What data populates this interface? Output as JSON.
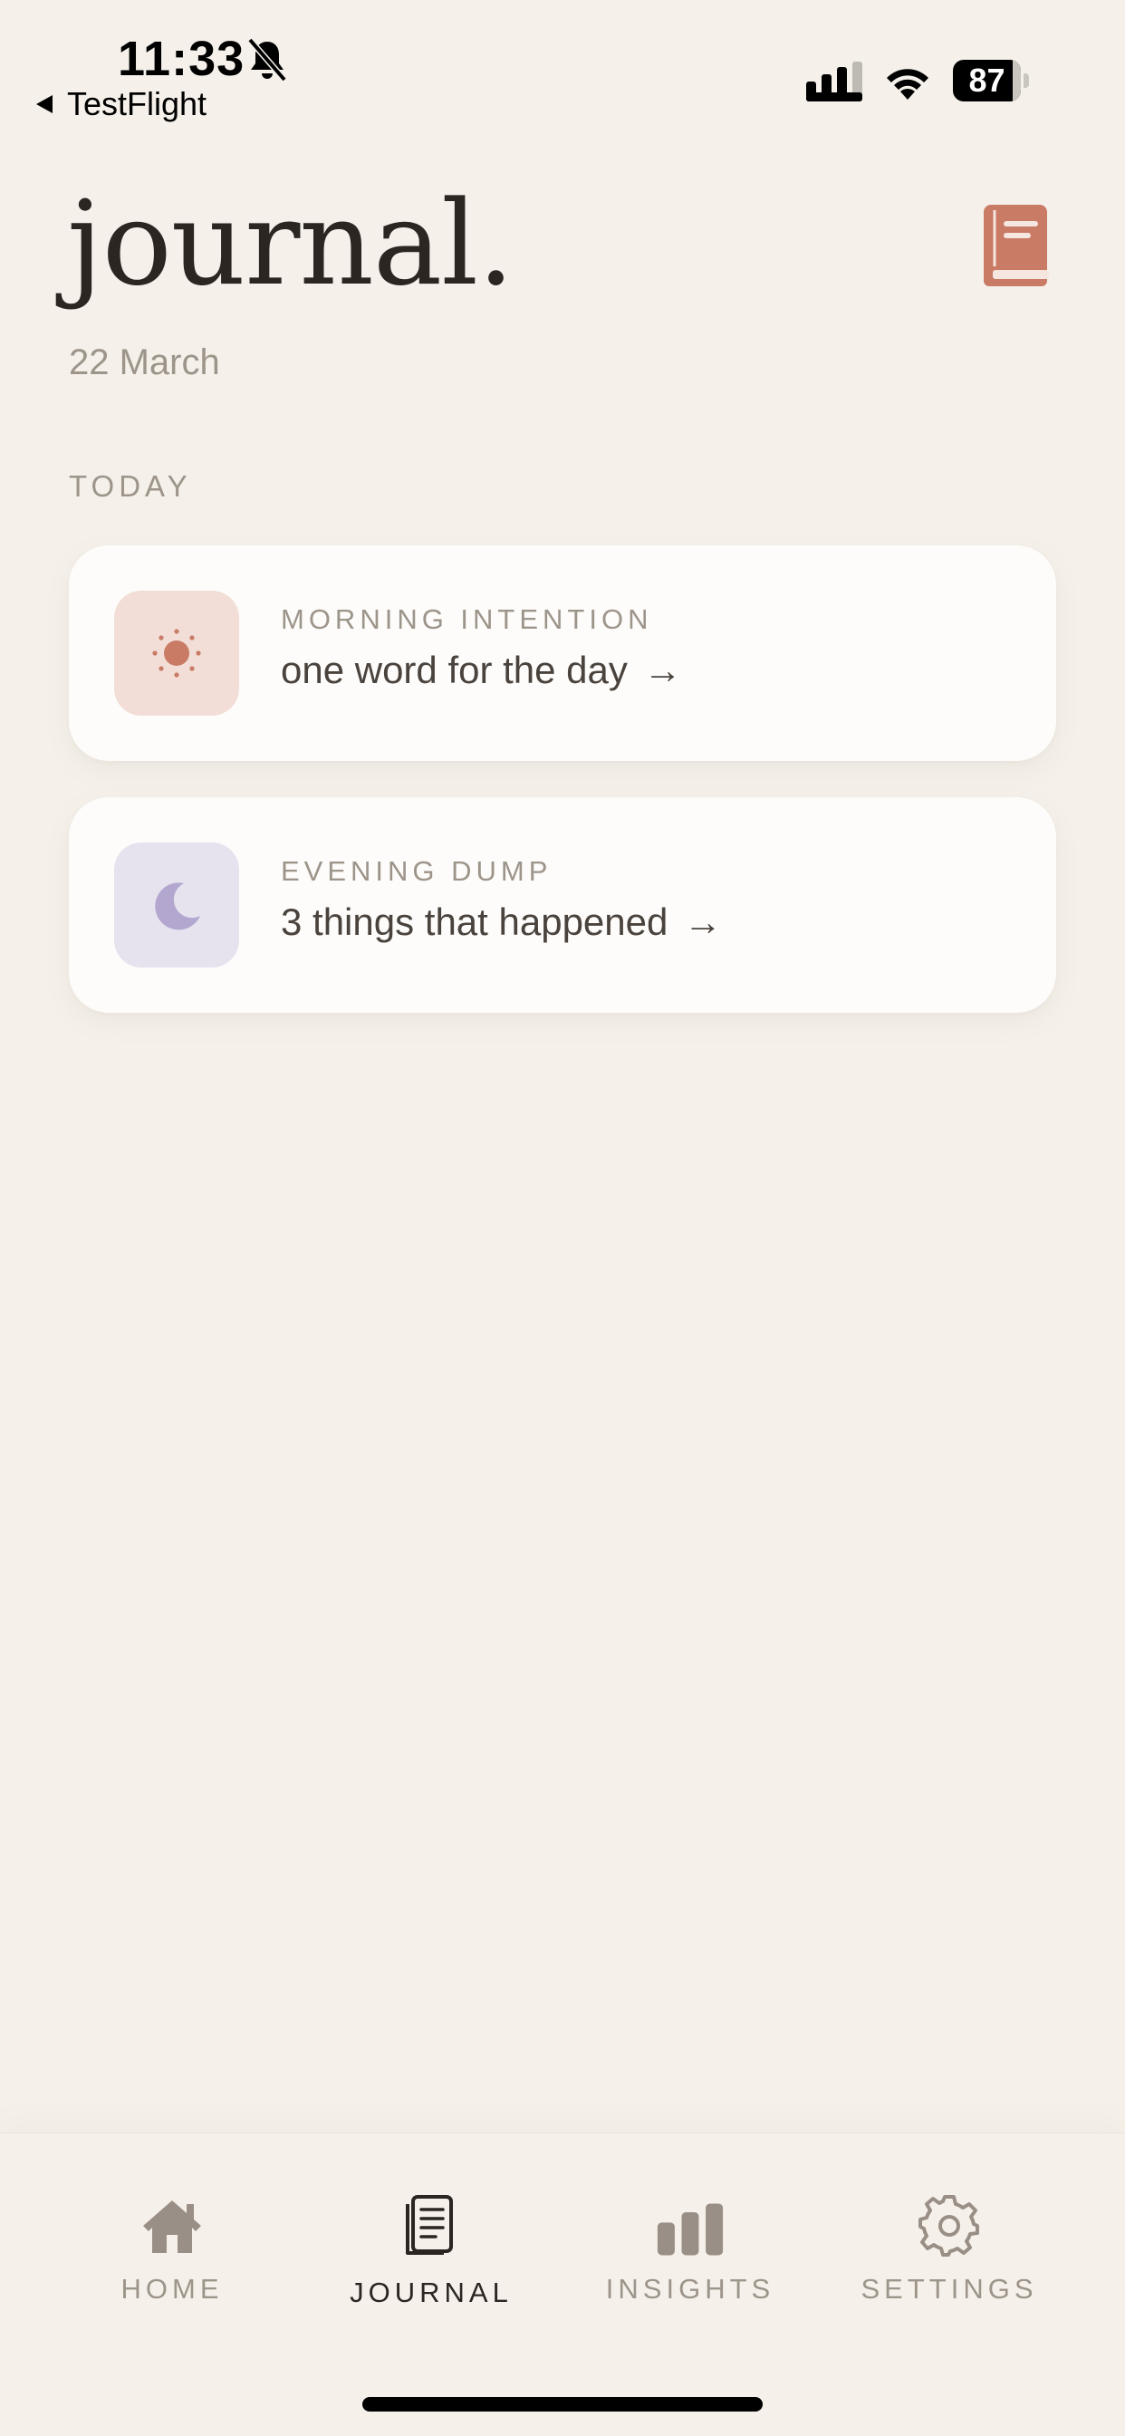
{
  "status_bar": {
    "time": "11:33",
    "back_label": "TestFlight",
    "battery_level": "87",
    "icons": [
      "bell-off-icon",
      "back-arrow-icon",
      "signal-icon",
      "wifi-icon",
      "battery-icon"
    ]
  },
  "header": {
    "title": "journal.",
    "date": "22 March",
    "action_icon": "book-icon"
  },
  "today": {
    "section_label": "TODAY",
    "cards": [
      {
        "label": "MORNING INTENTION",
        "prompt": "one word for the day",
        "arrow": "→",
        "icon": "sun-icon"
      },
      {
        "label": "EVENING DUMP",
        "prompt": "3 things that happened",
        "arrow": "→",
        "icon": "moon-icon"
      }
    ]
  },
  "tab_bar": {
    "active": "JOURNAL",
    "tabs": [
      {
        "label": "HOME",
        "icon": "home-icon"
      },
      {
        "label": "JOURNAL",
        "icon": "journal-icon"
      },
      {
        "label": "INSIGHTS",
        "icon": "bar-chart-icon"
      },
      {
        "label": "SETTINGS",
        "icon": "gear-icon"
      }
    ]
  },
  "colors": {
    "background": "#F5F1EA",
    "card": "#FDFCFA",
    "accent_terracotta": "#C97B66",
    "accent_lavender": "#B3A7CF",
    "text_primary": "#2B2622",
    "text_muted": "#9D948A",
    "tab_icon_inactive": "#9A8F86"
  }
}
